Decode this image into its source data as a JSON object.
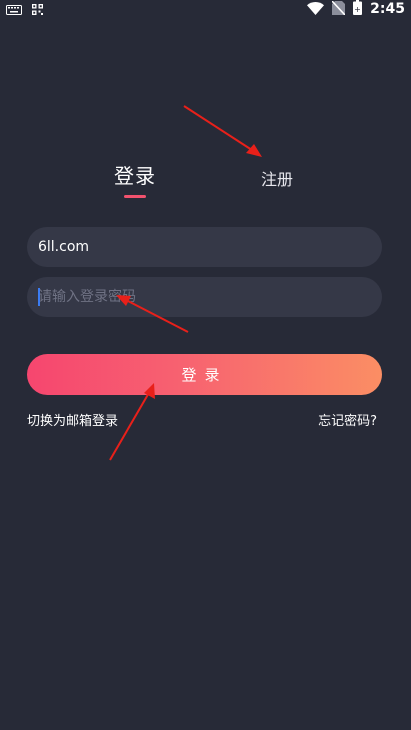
{
  "status_bar": {
    "time": "2:45",
    "icons": [
      "keyboard-icon",
      "qr-icon",
      "wifi-icon",
      "no-sim-icon",
      "battery-icon"
    ],
    "battery_level": 0.85
  },
  "tabs": {
    "login": "登录",
    "register": "注册"
  },
  "form": {
    "account_value": "6ll.com",
    "password_placeholder": "请输入登录密码",
    "submit_label": "登录"
  },
  "links": {
    "email_login": "切换为邮箱登录",
    "forgot_password": "忘记密码?"
  },
  "colors": {
    "background": "#272a37",
    "input_bg": "#353847",
    "accent": "#f2526e",
    "gradient_start": "#f6466f",
    "gradient_end": "#fb8e64",
    "arrow": "#e8201a"
  }
}
